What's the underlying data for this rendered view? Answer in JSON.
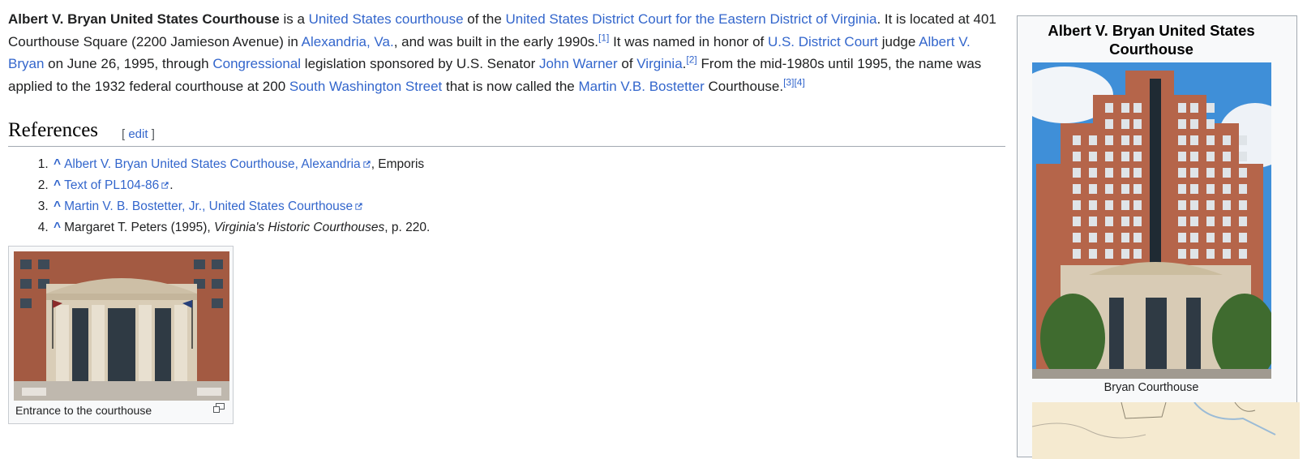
{
  "lead": {
    "s1_bold": "Albert V. Bryan United States Courthouse",
    "s1_a": " is a ",
    "s1_link1": "United States courthouse",
    "s1_b": " of the ",
    "s1_link2": "United States District Court for the Eastern District of Virginia",
    "s1_c": ". It is located at 401 Courthouse Square (2200 Jamieson Avenue) in ",
    "s1_link3": "Alexandria, Va.",
    "s1_d": ", and was built in the early 1990s.",
    "cite1": "[1]",
    "s2_a": " It was named in honor of ",
    "s2_link1": "U.S. District Court",
    "s2_b": " judge ",
    "s2_link2": "Albert V. Bryan",
    "s2_c": " on June 26, 1995, through ",
    "s2_link3": "Congressional",
    "s2_d": " legislation sponsored by U.S. Senator ",
    "s2_link4": "John Warner",
    "s2_e": " of ",
    "s2_link5": "Virginia",
    "s2_f": ".",
    "cite2": "[2]",
    "s3_a": " From the mid-1980s until 1995, the name was applied to the 1932 federal courthouse at 200 ",
    "s3_link1": "South Washington Street",
    "s3_b": " that is now called the ",
    "s3_link2": "Martin V.B. Bostetter",
    "s3_c": " Courthouse.",
    "cite3": "[3]",
    "cite4": "[4]"
  },
  "references": {
    "title": "References",
    "edit_open": "[ ",
    "edit_label": "edit",
    "edit_close": " ]",
    "caret": "^",
    "items": [
      {
        "link": "Albert V. Bryan United States Courthouse, Alexandria",
        "suffix": ", Emporis"
      },
      {
        "link": "Text of PL104-86",
        "suffix": "."
      },
      {
        "link": "Martin V. B. Bostetter, Jr., United States Courthouse",
        "suffix": ""
      },
      {
        "plain": "Margaret T. Peters (1995), ",
        "italic": "Virginia's Historic Courthouses",
        "suffix": ", p. 220."
      }
    ]
  },
  "thumb": {
    "caption": "Entrance to the courthouse",
    "icon": "magnify-icon"
  },
  "infobox": {
    "title": "Albert V. Bryan United States Courthouse",
    "image_caption": "Bryan Courthouse"
  },
  "colors": {
    "link": "#3366cc",
    "text": "#202122",
    "brick": "#b5654a",
    "sky": "#3f8fd8",
    "stone": "#d8cbb5"
  }
}
